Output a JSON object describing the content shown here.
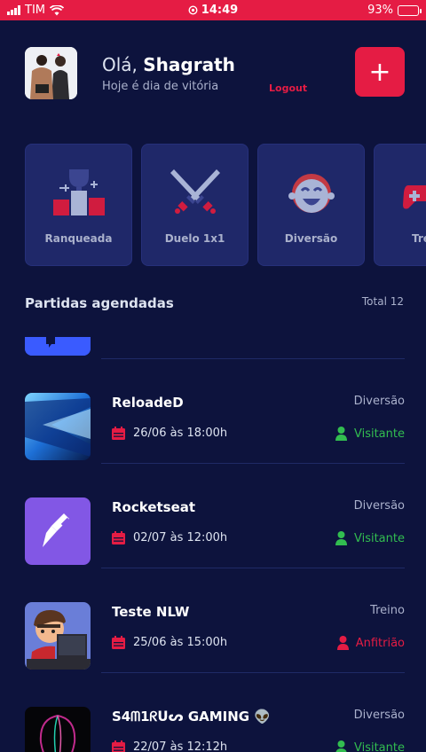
{
  "status_bar": {
    "carrier": "TIM",
    "time": "14:49",
    "battery": "93%"
  },
  "header": {
    "greeting_prefix": "Olá,",
    "user_name": "Shagrath",
    "subtitle": "Hoje é dia de vitória",
    "logout_label": "Logout",
    "add_label": "+"
  },
  "categories": [
    {
      "label": "Ranqueada",
      "icon": "trophy-icon"
    },
    {
      "label": "Duelo 1x1",
      "icon": "crossed-swords-icon"
    },
    {
      "label": "Diversão",
      "icon": "laughing-face-icon"
    },
    {
      "label": "Tre",
      "icon": "gamepad-icon"
    }
  ],
  "section": {
    "title": "Partidas agendadas",
    "total": "Total 12"
  },
  "matches": [
    {
      "name": "ReloadeD",
      "category": "Diversão",
      "datetime": "26/06 às 18:00h",
      "role": "Visitante",
      "role_type": "guest"
    },
    {
      "name": "Rocketseat",
      "category": "Diversão",
      "datetime": "02/07 às 12:00h",
      "role": "Visitante",
      "role_type": "guest"
    },
    {
      "name": "Teste NLW",
      "category": "Treino",
      "datetime": "25/06 às 15:00h",
      "role": "Anfitrião",
      "role_type": "host"
    },
    {
      "name": "S4ᗰ1ᖇᑌᔕ GAMING 👽",
      "category": "Diversão",
      "datetime": "22/07 às 12:12h",
      "role": "Visitante",
      "role_type": "guest"
    }
  ],
  "colors": {
    "background": "#0d133d",
    "accent": "#e51c44",
    "card": "#1f2869",
    "guest": "#32bd50",
    "host": "#e51c44"
  }
}
